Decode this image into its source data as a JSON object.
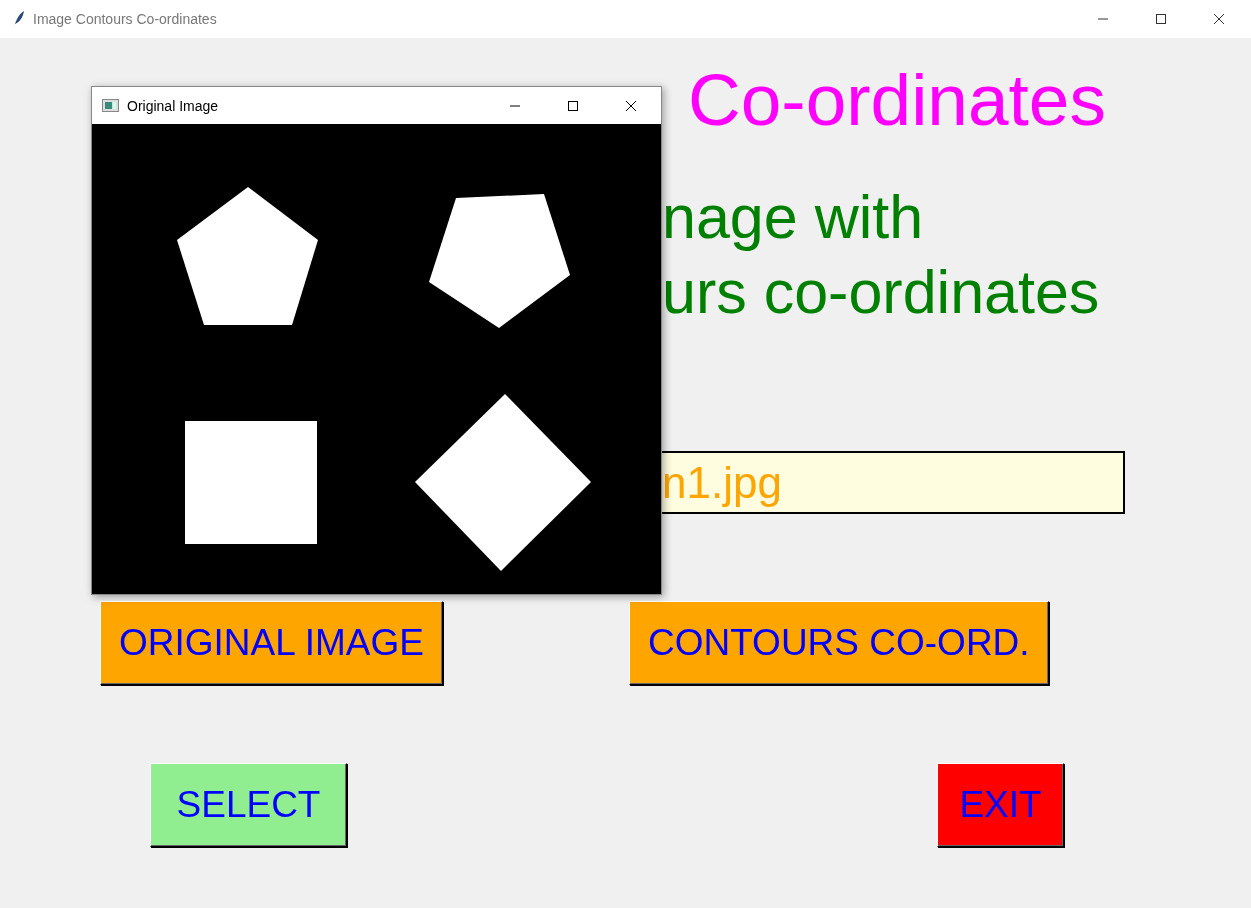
{
  "window": {
    "title": "Image Contours Co-ordinates"
  },
  "heading": "Co-ordinates",
  "subtitle": [
    "nage with",
    "urs co-ordinates"
  ],
  "file_field": {
    "value": "n1.jpg"
  },
  "buttons": [
    {
      "label": "ORIGINAL IMAGE",
      "color": "#ffa500"
    },
    {
      "label": "CONTOURS CO-ORD.",
      "color": "#ffa500"
    },
    {
      "label": "SELECT",
      "color": "#90ee90"
    },
    {
      "label": "EXIT",
      "color": "#ff0000"
    }
  ],
  "image_window": {
    "title": "Original Image"
  }
}
